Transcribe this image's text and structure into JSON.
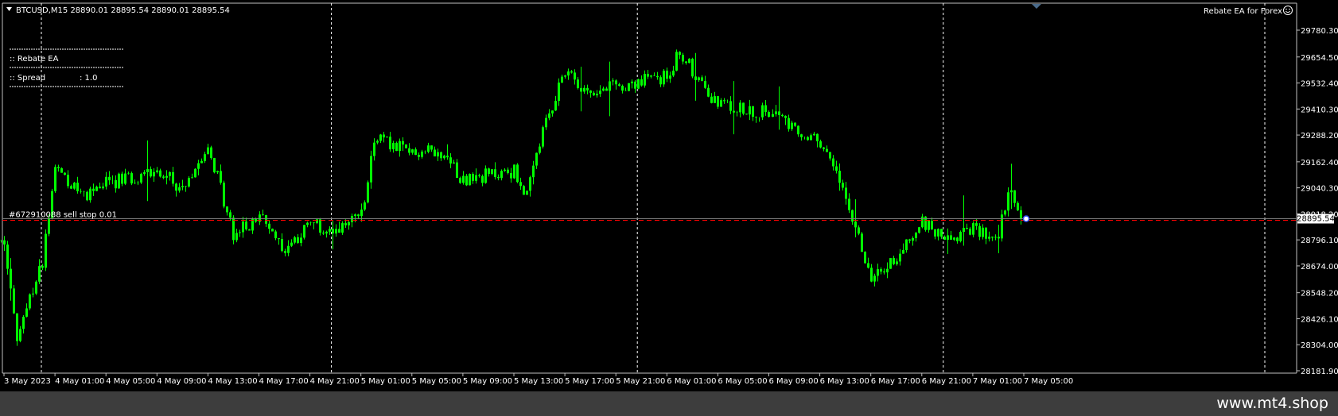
{
  "header": {
    "symbol_line": "BTCUSD,M15  28890.01 28895.54 28890.01 28895.54",
    "ea_name": "Rebate EA for Forex"
  },
  "info_panel": {
    "title": ":: Rebate EA",
    "spread_label": ":: Spread",
    "spread_value": ": 1.0"
  },
  "order": {
    "label": "#672910088 sell stop 0.01",
    "price": 28895.54
  },
  "current_price_label": "28895.54",
  "footer": {
    "brand": "www.mt4.shop"
  },
  "colors": {
    "background": "#000000",
    "candles": "#00ff00",
    "grid": "#ffffff",
    "order_line": "#ff0000",
    "bid_line": "#808080"
  },
  "chart_data": {
    "type": "candlestick",
    "timeframe": "M15",
    "symbol": "BTCUSD",
    "ylim": [
      28181.9,
      29780.3
    ],
    "y_ticks": [
      "29780.30",
      "29654.50",
      "29532.40",
      "29410.30",
      "29288.20",
      "29162.40",
      "29040.30",
      "28918.20",
      "28796.10",
      "28674.00",
      "28548.20",
      "28426.10",
      "28304.00",
      "28181.90"
    ],
    "x_ticks": [
      "3 May 2023",
      "4 May 01:00",
      "4 May 05:00",
      "4 May 09:00",
      "4 May 13:00",
      "4 May 17:00",
      "4 May 21:00",
      "5 May 01:00",
      "5 May 05:00",
      "5 May 09:00",
      "5 May 13:00",
      "5 May 17:00",
      "5 May 21:00",
      "6 May 01:00",
      "6 May 05:00",
      "6 May 09:00",
      "6 May 13:00",
      "6 May 17:00",
      "6 May 21:00",
      "7 May 01:00",
      "7 May 05:00"
    ],
    "price_path": [
      [
        "3 May 2023",
        28800
      ],
      [
        "3 May 22:00",
        28320
      ],
      [
        "4 May 00:00",
        28700
      ],
      [
        "4 May 01:00",
        29150
      ],
      [
        "4 May 03:00",
        29000
      ],
      [
        "4 May 05:00",
        29060
      ],
      [
        "4 May 09:00",
        29120
      ],
      [
        "4 May 11:00",
        29040
      ],
      [
        "4 May 13:00",
        29250
      ],
      [
        "4 May 15:00",
        28820
      ],
      [
        "4 May 17:00",
        28900
      ],
      [
        "4 May 19:00",
        28760
      ],
      [
        "4 May 21:00",
        28870
      ],
      [
        "4 May 23:00",
        28820
      ],
      [
        "5 May 01:00",
        28910
      ],
      [
        "5 May 02:00",
        29280
      ],
      [
        "5 May 05:00",
        29200
      ],
      [
        "5 May 07:00",
        29220
      ],
      [
        "5 May 09:00",
        29080
      ],
      [
        "5 May 13:00",
        29120
      ],
      [
        "5 May 14:00",
        29000
      ],
      [
        "5 May 15:00",
        29250
      ],
      [
        "5 May 17:00",
        29600
      ],
      [
        "5 May 19:00",
        29480
      ],
      [
        "5 May 21:00",
        29520
      ],
      [
        "6 May 01:00",
        29560
      ],
      [
        "6 May 02:00",
        29680
      ],
      [
        "6 May 05:00",
        29420
      ],
      [
        "6 May 09:00",
        29400
      ],
      [
        "6 May 11:00",
        29300
      ],
      [
        "6 May 13:00",
        29260
      ],
      [
        "6 May 15:00",
        29000
      ],
      [
        "6 May 17:00",
        28600
      ],
      [
        "6 May 19:00",
        28720
      ],
      [
        "6 May 21:00",
        28880
      ],
      [
        "6 May 23:00",
        28800
      ],
      [
        "7 May 01:00",
        28840
      ],
      [
        "7 May 03:00",
        28830
      ],
      [
        "7 May 04:00",
        29040
      ],
      [
        "7 May 05:00",
        28895.54
      ]
    ]
  }
}
